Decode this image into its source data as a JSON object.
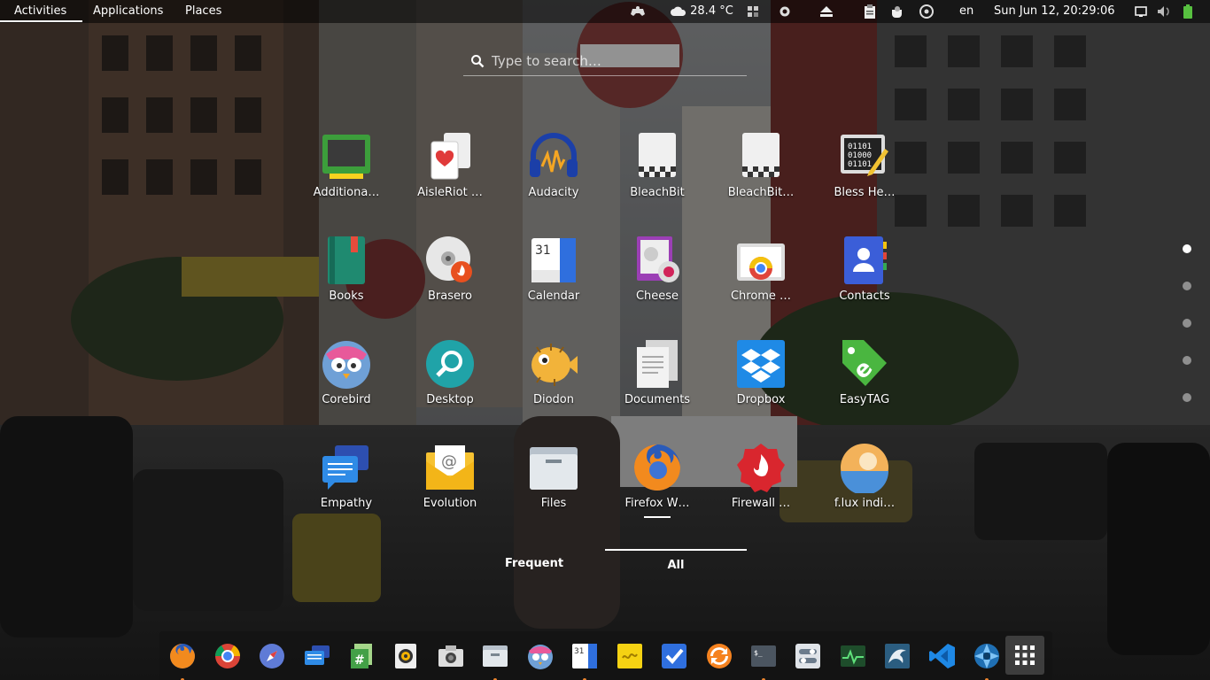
{
  "topbar": {
    "activities": "Activities",
    "applications": "Applications",
    "places": "Places",
    "weather_temp": "28.4 °C",
    "language": "en",
    "datetime": "Sun Jun 12, 20:29:06"
  },
  "search": {
    "placeholder": "Type to search…"
  },
  "apps": [
    {
      "label": "Additiona…",
      "icon": "additional-drivers-icon"
    },
    {
      "label": "AisleRiot …",
      "icon": "aisleriot-cards-icon"
    },
    {
      "label": "Audacity",
      "icon": "audacity-headphones-icon"
    },
    {
      "label": "BleachBit",
      "icon": "bleachbit-icon"
    },
    {
      "label": "BleachBit…",
      "icon": "bleachbit-root-icon"
    },
    {
      "label": "Bless He…",
      "icon": "bless-hex-editor-icon"
    },
    {
      "label": "Books",
      "icon": "books-icon"
    },
    {
      "label": "Brasero",
      "icon": "brasero-disc-icon"
    },
    {
      "label": "Calendar",
      "icon": "calendar-icon"
    },
    {
      "label": "Cheese",
      "icon": "cheese-webcam-icon"
    },
    {
      "label": "Chrome …",
      "icon": "chrome-app-launcher-icon"
    },
    {
      "label": "Contacts",
      "icon": "contacts-icon"
    },
    {
      "label": "Corebird",
      "icon": "corebird-bird-icon"
    },
    {
      "label": "Desktop",
      "icon": "desktop-search-icon"
    },
    {
      "label": "Diodon",
      "icon": "diodon-pufferfish-icon"
    },
    {
      "label": "Documents",
      "icon": "documents-icon"
    },
    {
      "label": "Dropbox",
      "icon": "dropbox-icon"
    },
    {
      "label": "EasyTAG",
      "icon": "easytag-tag-icon"
    },
    {
      "label": "Empathy",
      "icon": "empathy-chat-icon"
    },
    {
      "label": "Evolution",
      "icon": "evolution-mail-icon"
    },
    {
      "label": "Files",
      "icon": "files-folder-icon"
    },
    {
      "label": "Firefox W…",
      "icon": "firefox-icon"
    },
    {
      "label": "Firewall …",
      "icon": "firewall-icon"
    },
    {
      "label": "f.lux indi…",
      "icon": "flux-sunset-icon"
    }
  ],
  "view_switch": {
    "frequent": "Frequent",
    "all": "All",
    "active": "All"
  },
  "page_indicator": {
    "pages": 5,
    "current": 1
  },
  "dock": [
    "firefox-icon",
    "chrome-icon",
    "safari-compass-icon",
    "chat-bubbles-icon",
    "spreadsheet-icon",
    "audio-speaker-icon",
    "camera-icon",
    "files-icon",
    "corebird-icon",
    "calendar-icon",
    "sticky-note-icon",
    "tasks-check-icon",
    "software-update-icon",
    "terminal-icon",
    "settings-toggle-icon",
    "system-monitor-icon",
    "mysql-dolphin-icon",
    "vscode-icon",
    "shutter-aperture-icon",
    "show-applications-icon"
  ],
  "colors": {
    "accent_dot": "#e8822d",
    "topbar_bg": "#000000"
  }
}
